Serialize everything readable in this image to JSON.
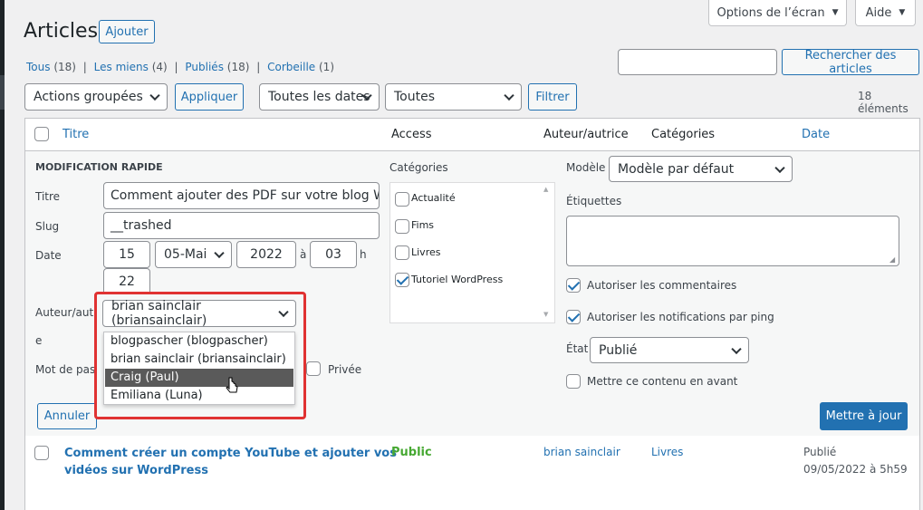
{
  "page": {
    "title": "Articles",
    "add_button": "Ajouter"
  },
  "screen_meta": {
    "options": "Options de l’écran",
    "help": "Aide"
  },
  "filters": {
    "all": "Tous",
    "all_count": "(18)",
    "mine": "Les miens",
    "mine_count": "(4)",
    "published": "Publiés",
    "published_count": "(18)",
    "trash": "Corbeille",
    "trash_count": "(1)",
    "sep": "|"
  },
  "search": {
    "value": "",
    "button": "Rechercher des articles"
  },
  "toolbar": {
    "bulk_actions": "Actions groupées",
    "apply": "Appliquer",
    "dates": "Toutes les dates",
    "categories": "Toutes",
    "filter": "Filtrer",
    "count": "18 éléments"
  },
  "table": {
    "headers": {
      "title": "Titre",
      "access": "Access",
      "author": "Auteur/autrice",
      "categories": "Catégories",
      "date": "Date"
    }
  },
  "quick_edit": {
    "heading": "MODIFICATION RAPIDE",
    "title_label": "Titre",
    "title_value": "Comment ajouter des PDF sur votre blog Word",
    "slug_label": "Slug",
    "slug_value": "__trashed",
    "date_label": "Date",
    "day": "15",
    "month": "05-Mai",
    "year": "2022",
    "at": "à",
    "hour": "03",
    "h": "h",
    "minute": "22",
    "author_label": "Auteur/autrice",
    "author_value": "brian sainclair (briansainclair)",
    "password_label": "Mot de passe",
    "password_label_extra": "e",
    "private_label": "Privée",
    "cancel": "Annuler",
    "categories_label": "Catégories",
    "categories": [
      {
        "label": "Actualité",
        "checked": false
      },
      {
        "label": "Fims",
        "checked": false
      },
      {
        "label": "Livres",
        "checked": false
      },
      {
        "label": "Tutoriel WordPress",
        "checked": true
      }
    ],
    "template_label": "Modèle",
    "template_value": "Modèle par défaut",
    "tags_label": "Étiquettes",
    "allow_comments": "Autoriser les commentaires",
    "allow_pings": "Autoriser les notifications par ping",
    "status_label": "État",
    "status_value": "Publié",
    "sticky": "Mettre ce contenu en avant",
    "update": "Mettre à jour",
    "author_options": [
      "blogpascher (blogpascher)",
      "brian sainclair (briansainclair)",
      "Craig (Paul)",
      "Emiliana (Luna)"
    ],
    "highlight_color": "#e03232"
  },
  "rows": [
    {
      "title_line1": "Comment créer un compte YouTube et ajouter vos",
      "title_line2": "vidéos sur WordPress",
      "access": "Public",
      "author": "brian sainclair",
      "category": "Livres",
      "status": "Publié",
      "date": "09/05/2022 à 5h59"
    }
  ]
}
